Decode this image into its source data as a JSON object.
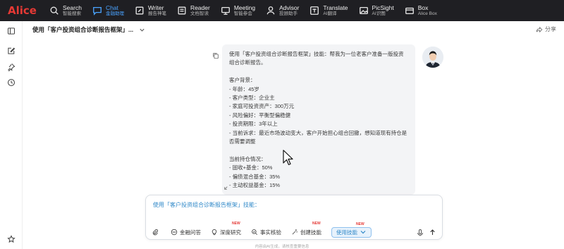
{
  "app": {
    "logo": "Alice"
  },
  "nav": [
    {
      "title": "Search",
      "sub": "智能搜索",
      "icon": "search-icon",
      "active": false
    },
    {
      "title": "Chat",
      "sub": "金融助理",
      "icon": "chat-icon",
      "active": true
    },
    {
      "title": "Writer",
      "sub": "报告神笔",
      "icon": "pen-icon",
      "active": false
    },
    {
      "title": "Reader",
      "sub": "文档智读",
      "icon": "book-icon",
      "active": false
    },
    {
      "title": "Meeting",
      "sub": "智能参会",
      "icon": "meeting-icon",
      "active": false
    },
    {
      "title": "Advisor",
      "sub": "投顾助手",
      "icon": "advisor-icon",
      "active": false
    },
    {
      "title": "Translate",
      "sub": "AI翻译",
      "icon": "translate-icon",
      "active": false
    },
    {
      "title": "PicSight",
      "sub": "AI识图",
      "icon": "image-icon",
      "active": false
    },
    {
      "title": "Box",
      "sub": "Alice Box",
      "icon": "box-icon",
      "active": false
    }
  ],
  "conversation": {
    "title": "使用「客户投资组合诊断报告框架」...",
    "share_label": "分享"
  },
  "message": {
    "text": "使用「客户投资组合诊断报告框架」技能：帮我为一位老客户准备一版投资组合诊断报告。\n\n客户背景：\n- 年龄：45岁\n- 客户类型：企业主\n- 家庭可投资资产：300万元\n- 风险偏好：平衡型偏稳健\n- 投资期限：3年以上\n- 当前诉求：最近市场波动变大，客户开始担心组合回撤，想知道现有持仓是否需要调整\n\n当前持仓情况：\n- 固收+基金：50%\n- 偏债混合基金：35%\n- 主动权益基金：15%"
  },
  "composer": {
    "input_value": "使用「客户投资组合诊断报告框架」技能：",
    "tools": [
      {
        "label": "金融问答",
        "icon": "chat-bubble-icon",
        "new": false,
        "selected": false
      },
      {
        "label": "深度研究",
        "icon": "bulb-icon",
        "new": true,
        "selected": false
      },
      {
        "label": "事实核验",
        "icon": "check-search-icon",
        "new": false,
        "selected": false
      },
      {
        "label": "创建技能",
        "icon": "wand-icon",
        "new": true,
        "selected": false
      },
      {
        "label": "使用技能",
        "icon": "chevron-down-icon",
        "new": true,
        "selected": true
      }
    ],
    "new_badge": "NEW"
  },
  "disclaimer": "内容由AI生成，请核查重要信息",
  "colors": {
    "topbar": "#1f1f23",
    "brand": "#e53935",
    "accent": "#4aa3ff",
    "link": "#2f88c8"
  }
}
